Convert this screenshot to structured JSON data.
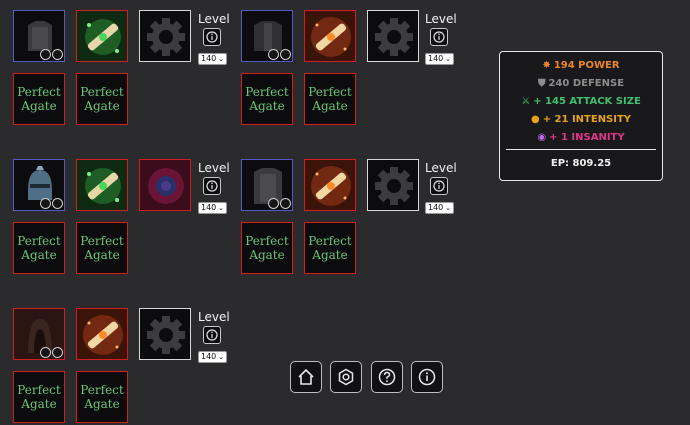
{
  "gem_label": "Perfect\nAgate",
  "level": {
    "label": "Level",
    "value": "140"
  },
  "stats": {
    "power": "194 POWER",
    "defense": "240 DEFENSE",
    "attack_size": "+ 145 ATTACK SIZE",
    "intensity": "+ 21 INTENSITY",
    "insanity": "+ 1 INSANITY",
    "ep": "EP: 809.25"
  },
  "colors": {
    "power": "#e8872a",
    "defense": "#8d8d8d",
    "attack_size": "#3fbf6f",
    "intensity": "#e8a21a",
    "insanity": "#e0358a",
    "gem_text": "#6cc477"
  },
  "nav": {
    "home_icon": "home-icon",
    "settings_icon": "hexagon-settings-icon",
    "help_icon": "question-icon",
    "info_icon": "info-icon"
  }
}
